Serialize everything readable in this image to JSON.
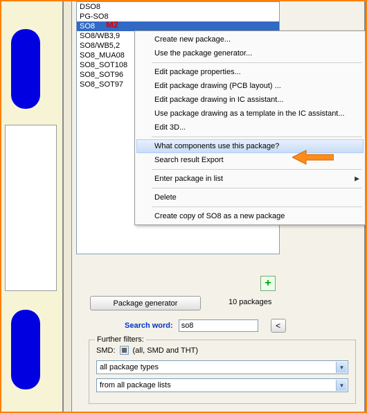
{
  "list": {
    "items": [
      "DSO8",
      "PG-SO8",
      "SO8",
      "SO8/WB3,9",
      "SO8/WB5,2",
      "SO8_MUA08",
      "SO8_SOT108",
      "SO8_SOT96",
      "SO8_SOT97"
    ],
    "selected_index": 2
  },
  "annotation_m2": "M2",
  "context_menu": {
    "create_new": "Create new package...",
    "use_generator": "Use the package generator...",
    "edit_props": "Edit package properties...",
    "edit_pcb": "Edit package drawing (PCB layout) ...",
    "edit_ic": "Edit package drawing in IC assistant...",
    "use_template": "Use package drawing as a template in the IC assistant...",
    "edit_3d": "Edit 3D...",
    "what_components": "What components use this package?",
    "search_export": "Search result Export",
    "enter_in_list": "Enter package in list",
    "delete": "Delete",
    "create_copy": "Create copy of SO8 as a new package"
  },
  "buttons": {
    "package_generator": "Package generator",
    "package_count": "10 packages",
    "add_icon": "+"
  },
  "search": {
    "label": "Search word:",
    "value": "so8",
    "back": "<"
  },
  "filters": {
    "legend": "Further filters:",
    "smd_label": "SMD:",
    "smd_value": "(all, SMD and THT)",
    "package_types": "all package types",
    "package_lists": "from all package lists"
  }
}
